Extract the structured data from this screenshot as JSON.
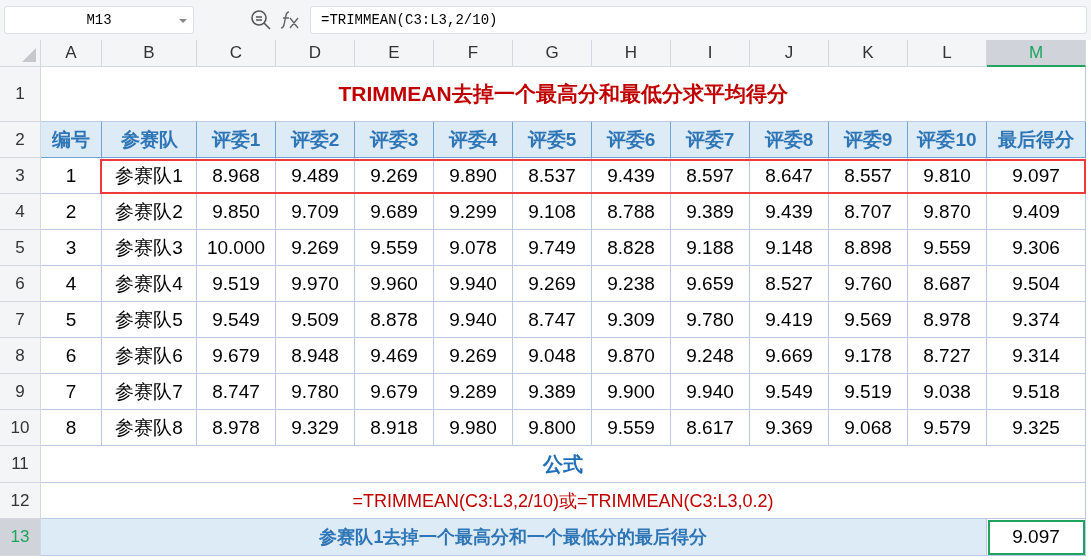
{
  "name_box": "M13",
  "formula": "=TRIMMEAN(C3:L3,2/10)",
  "columns": [
    {
      "label": "A",
      "selected": false
    },
    {
      "label": "B",
      "selected": false
    },
    {
      "label": "C",
      "selected": false
    },
    {
      "label": "D",
      "selected": false
    },
    {
      "label": "E",
      "selected": false
    },
    {
      "label": "F",
      "selected": false
    },
    {
      "label": "G",
      "selected": false
    },
    {
      "label": "H",
      "selected": false
    },
    {
      "label": "I",
      "selected": false
    },
    {
      "label": "J",
      "selected": false
    },
    {
      "label": "K",
      "selected": false
    },
    {
      "label": "L",
      "selected": false
    },
    {
      "label": "M",
      "selected": true
    }
  ],
  "row_numbers": [
    {
      "label": "1",
      "selected": false
    },
    {
      "label": "2",
      "selected": false
    },
    {
      "label": "3",
      "selected": false
    },
    {
      "label": "4",
      "selected": false
    },
    {
      "label": "5",
      "selected": false
    },
    {
      "label": "6",
      "selected": false
    },
    {
      "label": "7",
      "selected": false
    },
    {
      "label": "8",
      "selected": false
    },
    {
      "label": "9",
      "selected": false
    },
    {
      "label": "10",
      "selected": false
    },
    {
      "label": "11",
      "selected": false
    },
    {
      "label": "12",
      "selected": false
    },
    {
      "label": "13",
      "selected": true
    }
  ],
  "title": "TRIMMEAN去掉一个最高分和最低分求平均得分",
  "headers": [
    "编号",
    "参赛队",
    "评委1",
    "评委2",
    "评委3",
    "评委4",
    "评委5",
    "评委6",
    "评委7",
    "评委8",
    "评委9",
    "评委10",
    "最后得分"
  ],
  "rows": [
    {
      "cells": [
        "1",
        "参赛队1",
        "8.968",
        "9.489",
        "9.269",
        "9.890",
        "8.537",
        "9.439",
        "8.597",
        "8.647",
        "8.557",
        "9.810",
        "9.097"
      ],
      "highlighted": true
    },
    {
      "cells": [
        "2",
        "参赛队2",
        "9.850",
        "9.709",
        "9.689",
        "9.299",
        "9.108",
        "8.788",
        "9.389",
        "9.439",
        "8.707",
        "9.870",
        "9.409"
      ],
      "highlighted": false
    },
    {
      "cells": [
        "3",
        "参赛队3",
        "10.000",
        "9.269",
        "9.559",
        "9.078",
        "9.749",
        "8.828",
        "9.188",
        "9.148",
        "8.898",
        "9.559",
        "9.306"
      ],
      "highlighted": false
    },
    {
      "cells": [
        "4",
        "参赛队4",
        "9.519",
        "9.970",
        "9.960",
        "9.940",
        "9.269",
        "9.238",
        "9.659",
        "8.527",
        "9.760",
        "8.687",
        "9.504"
      ],
      "highlighted": false
    },
    {
      "cells": [
        "5",
        "参赛队5",
        "9.549",
        "9.509",
        "8.878",
        "9.940",
        "8.747",
        "9.309",
        "9.780",
        "9.419",
        "9.569",
        "8.978",
        "9.374"
      ],
      "highlighted": false
    },
    {
      "cells": [
        "6",
        "参赛队6",
        "9.679",
        "8.948",
        "9.469",
        "9.269",
        "9.048",
        "9.870",
        "9.248",
        "9.669",
        "9.178",
        "8.727",
        "9.314"
      ],
      "highlighted": false
    },
    {
      "cells": [
        "7",
        "参赛队7",
        "8.747",
        "9.780",
        "9.679",
        "9.289",
        "9.389",
        "9.900",
        "9.940",
        "9.549",
        "9.519",
        "9.038",
        "9.518"
      ],
      "highlighted": false
    },
    {
      "cells": [
        "8",
        "参赛队8",
        "8.978",
        "9.329",
        "8.918",
        "9.980",
        "9.800",
        "9.559",
        "8.617",
        "9.369",
        "9.068",
        "9.579",
        "9.325"
      ],
      "highlighted": false
    }
  ],
  "section_label": "公式",
  "formula_note": "=TRIMMEAN(C3:L3,2/10)或=TRIMMEAN(C3:L3,0.2)",
  "result": {
    "label": "参赛队1去掉一个最高分和一个最低分的最后得分",
    "value": "9.097",
    "selected": true
  }
}
